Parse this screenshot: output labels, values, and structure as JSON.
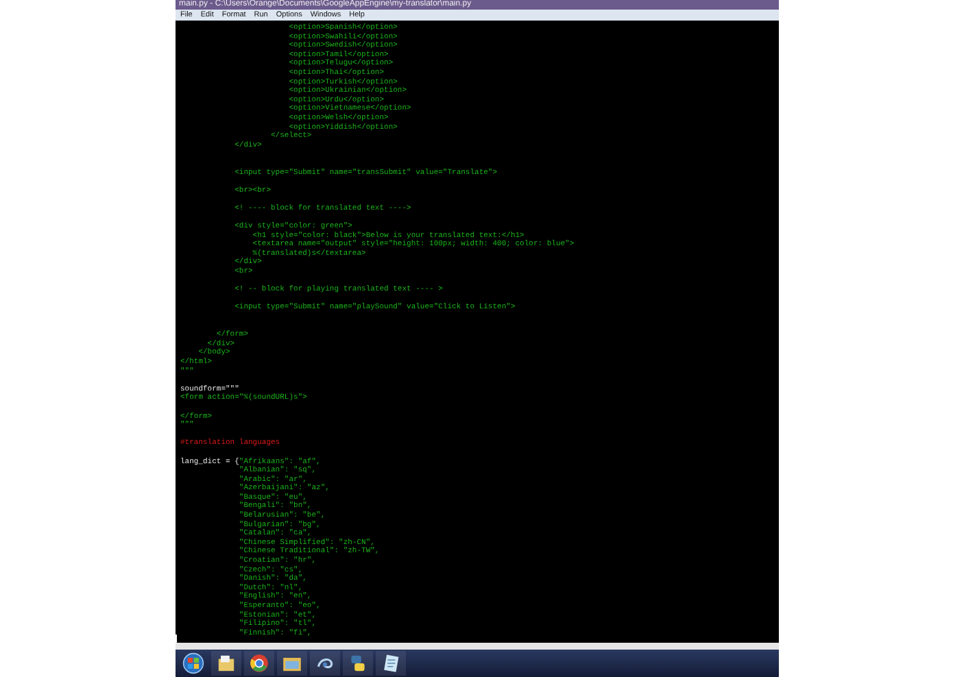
{
  "window": {
    "title": "main.py - C:\\Users\\Orange\\Documents\\GoogleAppEngine\\my-translator\\main.py"
  },
  "menu": [
    "File",
    "Edit",
    "Format",
    "Run",
    "Options",
    "Windows",
    "Help"
  ],
  "code_lines": [
    {
      "kind": "code",
      "parts": [
        {
          "kind": "markup",
          "text": "                        <option>Spanish</option>"
        }
      ]
    },
    {
      "kind": "code",
      "parts": [
        {
          "kind": "markup",
          "text": "                        <option>Swahili</option>"
        }
      ]
    },
    {
      "kind": "code",
      "parts": [
        {
          "kind": "markup",
          "text": "                        <option>Swedish</option>"
        }
      ]
    },
    {
      "kind": "code",
      "parts": [
        {
          "kind": "markup",
          "text": "                        <option>Tamil</option>"
        }
      ]
    },
    {
      "kind": "code",
      "parts": [
        {
          "kind": "markup",
          "text": "                        <option>Telugu</option>"
        }
      ]
    },
    {
      "kind": "code",
      "parts": [
        {
          "kind": "markup",
          "text": "                        <option>Thai</option>"
        }
      ]
    },
    {
      "kind": "code",
      "parts": [
        {
          "kind": "markup",
          "text": "                        <option>Turkish</option>"
        }
      ]
    },
    {
      "kind": "code",
      "parts": [
        {
          "kind": "markup",
          "text": "                        <option>Ukrainian</option>"
        }
      ]
    },
    {
      "kind": "code",
      "parts": [
        {
          "kind": "markup",
          "text": "                        <option>Urdu</option>"
        }
      ]
    },
    {
      "kind": "code",
      "parts": [
        {
          "kind": "markup",
          "text": "                        <option>Vietnamese</option>"
        }
      ]
    },
    {
      "kind": "code",
      "parts": [
        {
          "kind": "markup",
          "text": "                        <option>Welsh</option>"
        }
      ]
    },
    {
      "kind": "code",
      "parts": [
        {
          "kind": "markup",
          "text": "                        <option>Yiddish</option>"
        }
      ]
    },
    {
      "kind": "code",
      "parts": [
        {
          "kind": "markup",
          "text": "                    </select>"
        }
      ]
    },
    {
      "kind": "code",
      "parts": [
        {
          "kind": "markup",
          "text": "            </div>"
        }
      ]
    },
    {
      "kind": "blank"
    },
    {
      "kind": "blank"
    },
    {
      "kind": "code",
      "parts": [
        {
          "kind": "markup",
          "text": "            <input type=\"Submit\" name=\"transSubmit\" value=\"Translate\">"
        }
      ]
    },
    {
      "kind": "blank"
    },
    {
      "kind": "code",
      "parts": [
        {
          "kind": "markup",
          "text": "            <br><br>"
        }
      ]
    },
    {
      "kind": "blank"
    },
    {
      "kind": "code",
      "parts": [
        {
          "kind": "markup",
          "text": "            <! ---- block for translated text ---->"
        }
      ]
    },
    {
      "kind": "blank"
    },
    {
      "kind": "code",
      "parts": [
        {
          "kind": "markup",
          "text": "            <div style=\"color: green\">"
        }
      ]
    },
    {
      "kind": "code",
      "parts": [
        {
          "kind": "markup",
          "text": "                <h1 style=\"color: black\">Below is your translated text:</h1>"
        }
      ]
    },
    {
      "kind": "code",
      "parts": [
        {
          "kind": "markup",
          "text": "                <textarea name=\"output\" style=\"height: 100px; width: 400; color: blue\">"
        }
      ]
    },
    {
      "kind": "code",
      "parts": [
        {
          "kind": "markup",
          "text": "                %(translated)s</textarea>"
        }
      ]
    },
    {
      "kind": "code",
      "parts": [
        {
          "kind": "markup",
          "text": "            </div>"
        }
      ]
    },
    {
      "kind": "code",
      "parts": [
        {
          "kind": "markup",
          "text": "            <br>"
        }
      ]
    },
    {
      "kind": "blank"
    },
    {
      "kind": "code",
      "parts": [
        {
          "kind": "markup",
          "text": "            <! -- block for playing translated text ---- >"
        }
      ]
    },
    {
      "kind": "blank"
    },
    {
      "kind": "code",
      "parts": [
        {
          "kind": "markup",
          "text": "            <input type=\"Submit\" name=\"playSound\" value=\"Click to Listen\">"
        }
      ]
    },
    {
      "kind": "blank"
    },
    {
      "kind": "blank"
    },
    {
      "kind": "code",
      "parts": [
        {
          "kind": "markup",
          "text": "        </form>"
        }
      ]
    },
    {
      "kind": "code",
      "parts": [
        {
          "kind": "markup",
          "text": "      </div>"
        }
      ]
    },
    {
      "kind": "code",
      "parts": [
        {
          "kind": "markup",
          "text": "    </body>"
        }
      ]
    },
    {
      "kind": "code",
      "parts": [
        {
          "kind": "markup",
          "text": "</html>"
        }
      ]
    },
    {
      "kind": "code",
      "parts": [
        {
          "kind": "markup",
          "text": "\"\"\""
        }
      ]
    },
    {
      "kind": "blank"
    },
    {
      "kind": "code",
      "parts": [
        {
          "kind": "plain",
          "text": "soundform=\"\"\""
        }
      ]
    },
    {
      "kind": "code",
      "parts": [
        {
          "kind": "markup",
          "text": "<form action=\"%(soundURL)s\">"
        }
      ]
    },
    {
      "kind": "blank"
    },
    {
      "kind": "code",
      "parts": [
        {
          "kind": "markup",
          "text": "</form>"
        }
      ]
    },
    {
      "kind": "code",
      "parts": [
        {
          "kind": "markup",
          "text": "\"\"\""
        }
      ]
    },
    {
      "kind": "blank"
    },
    {
      "kind": "code",
      "parts": [
        {
          "kind": "comment",
          "text": "#translation languages"
        }
      ]
    },
    {
      "kind": "blank"
    },
    {
      "kind": "code",
      "parts": [
        {
          "kind": "plain",
          "text": "lang_dict = {"
        },
        {
          "kind": "markup",
          "text": "\"Afrikaans\": \"af\","
        }
      ]
    },
    {
      "kind": "code",
      "parts": [
        {
          "kind": "markup",
          "text": "             \"Albanian\": \"sq\","
        }
      ]
    },
    {
      "kind": "code",
      "parts": [
        {
          "kind": "markup",
          "text": "             \"Arabic\": \"ar\","
        }
      ]
    },
    {
      "kind": "code",
      "parts": [
        {
          "kind": "markup",
          "text": "             \"Azerbaijani\": \"az\","
        }
      ]
    },
    {
      "kind": "code",
      "parts": [
        {
          "kind": "markup",
          "text": "             \"Basque\": \"eu\","
        }
      ]
    },
    {
      "kind": "code",
      "parts": [
        {
          "kind": "markup",
          "text": "             \"Bengali\": \"bn\","
        }
      ]
    },
    {
      "kind": "code",
      "parts": [
        {
          "kind": "markup",
          "text": "             \"Belarusian\": \"be\","
        }
      ]
    },
    {
      "kind": "code",
      "parts": [
        {
          "kind": "markup",
          "text": "             \"Bulgarian\": \"bg\","
        }
      ]
    },
    {
      "kind": "code",
      "parts": [
        {
          "kind": "markup",
          "text": "             \"Catalan\": \"ca\","
        }
      ]
    },
    {
      "kind": "code",
      "parts": [
        {
          "kind": "markup",
          "text": "             \"Chinese Simplified\": \"zh-CN\","
        }
      ]
    },
    {
      "kind": "code",
      "parts": [
        {
          "kind": "markup",
          "text": "             \"Chinese Traditional\": \"zh-TW\","
        }
      ]
    },
    {
      "kind": "code",
      "parts": [
        {
          "kind": "markup",
          "text": "             \"Croatian\": \"hr\","
        }
      ]
    },
    {
      "kind": "code",
      "parts": [
        {
          "kind": "markup",
          "text": "             \"Czech\": \"cs\","
        }
      ]
    },
    {
      "kind": "code",
      "parts": [
        {
          "kind": "markup",
          "text": "             \"Danish\": \"da\","
        }
      ]
    },
    {
      "kind": "code",
      "parts": [
        {
          "kind": "markup",
          "text": "             \"Dutch\": \"nl\","
        }
      ]
    },
    {
      "kind": "code",
      "parts": [
        {
          "kind": "markup",
          "text": "             \"English\": \"en\","
        }
      ]
    },
    {
      "kind": "code",
      "parts": [
        {
          "kind": "markup",
          "text": "             \"Esperanto\": \"eo\","
        }
      ]
    },
    {
      "kind": "code",
      "parts": [
        {
          "kind": "markup",
          "text": "             \"Estonian\": \"et\","
        }
      ]
    },
    {
      "kind": "code",
      "parts": [
        {
          "kind": "markup",
          "text": "             \"Filipino\": \"tl\","
        }
      ]
    },
    {
      "kind": "code",
      "parts": [
        {
          "kind": "markup",
          "text": "             \"Finnish\": \"fi\","
        }
      ]
    }
  ],
  "taskbar": {
    "items": [
      {
        "kind": "start"
      },
      {
        "kind": "library"
      },
      {
        "kind": "browser"
      },
      {
        "kind": "folder"
      },
      {
        "kind": "swirl"
      },
      {
        "kind": "python"
      },
      {
        "kind": "notepad"
      }
    ]
  }
}
